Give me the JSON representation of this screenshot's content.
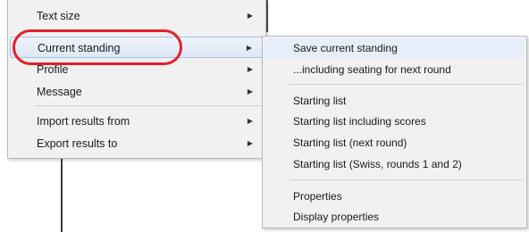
{
  "left_menu": {
    "items": [
      {
        "label": "Text size",
        "has_submenu": true
      },
      {
        "label": "Current standing",
        "has_submenu": true,
        "highlighted": true
      },
      {
        "label": "Profile",
        "has_submenu": true
      },
      {
        "label": "Message",
        "has_submenu": true
      },
      {
        "label": "Import results from",
        "has_submenu": true
      },
      {
        "label": "Export results to",
        "has_submenu": true
      }
    ],
    "submenu_arrow": "▶"
  },
  "submenu": {
    "items": [
      "Save current standing",
      "...including seating for next round",
      "Starting list",
      "Starting list including scores",
      "Starting list (next round)",
      "Starting list (Swiss, rounds 1 and 2)",
      "Properties",
      "Display properties"
    ]
  },
  "colors": {
    "menu_bg": "#f1f1f1",
    "hover_border": "#a8c1e6",
    "annotation_red": "#e4202a"
  }
}
